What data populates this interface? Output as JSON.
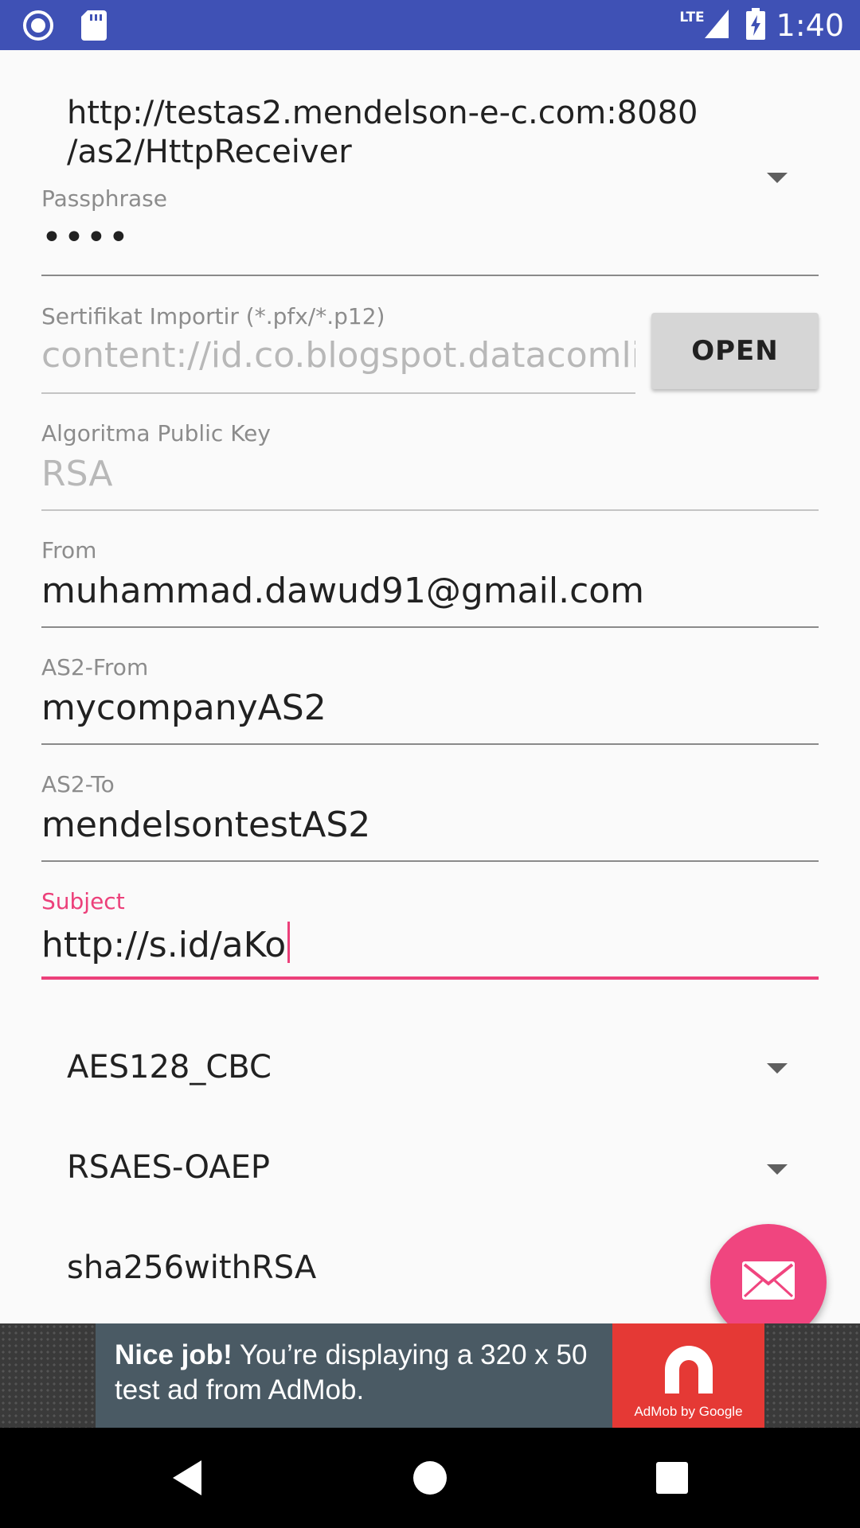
{
  "status_bar": {
    "time": "1:40",
    "network": "LTE",
    "icons": [
      "record-icon",
      "sd-card-icon",
      "signal-icon",
      "battery-charging-icon"
    ]
  },
  "form": {
    "url_spinner": {
      "value_line1": "http://testas2.mendelson-e-c.com:8080",
      "value_line2": "/as2/HttpReceiver"
    },
    "passphrase": {
      "label": "Passphrase",
      "value": "••••"
    },
    "certificate": {
      "label": "Sertifikat Importir (*.pfx/*.p12)",
      "value": "content://id.co.blogspot.datacomlin"
    },
    "open_button": "OPEN",
    "public_key": {
      "label": "Algoritma Public Key",
      "value": "RSA"
    },
    "from": {
      "label": "From",
      "value": "muhammad.dawud91@gmail.com"
    },
    "as2_from": {
      "label": "AS2-From",
      "value": "mycompanyAS2"
    },
    "as2_to": {
      "label": "AS2-To",
      "value": "mendelsontestAS2"
    },
    "subject": {
      "label": "Subject",
      "value": "http://s.id/aKo"
    },
    "encryption_spinner": "AES128_CBC",
    "key_transport_spinner": "RSAES-OAEP",
    "signature_spinner": "sha256withRSA"
  },
  "fab": {
    "icon": "mail-icon"
  },
  "ad": {
    "headline": "Nice job!",
    "body": " You’re displaying a 320 x 50 test ad from AdMob.",
    "logo_text": "AdMob by Google"
  },
  "colors": {
    "primary": "#3f51b5",
    "accent": "#ec407a",
    "ad_red": "#e53935"
  }
}
